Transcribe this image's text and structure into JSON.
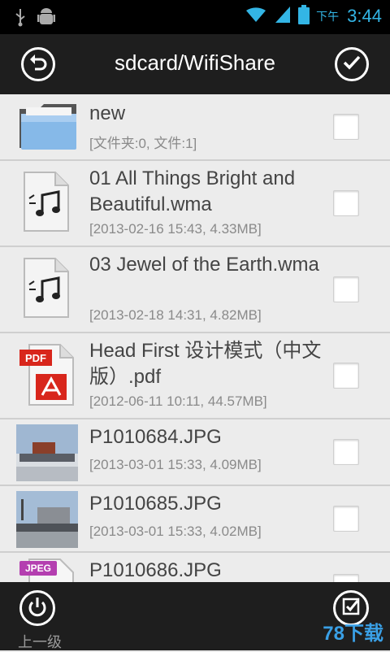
{
  "status": {
    "ampm": "下午",
    "time": "3:44"
  },
  "header": {
    "title": "sdcard/WifiShare"
  },
  "files": [
    {
      "name": "new",
      "meta": "[文件夹:0, 文件:1]",
      "icon": "folder-icon"
    },
    {
      "name": "01 All Things Bright and Beautiful.wma",
      "meta": "[2013-02-16 15:43, 4.33MB]",
      "icon": "audio-file-icon"
    },
    {
      "name": "03 Jewel of the Earth.wma",
      "meta": "[2013-02-18 14:31, 4.82MB]",
      "icon": "audio-file-icon"
    },
    {
      "name": "Head First 设计模式（中文版）.pdf",
      "meta": "[2012-06-11 10:11, 44.57MB]",
      "icon": "pdf-file-icon",
      "badge": "PDF"
    },
    {
      "name": "P1010684.JPG",
      "meta": "[2013-03-01 15:33, 4.09MB]",
      "icon": "photo-thumbnail"
    },
    {
      "name": "P1010685.JPG",
      "meta": "[2013-03-01 15:33, 4.02MB]",
      "icon": "photo-thumbnail"
    },
    {
      "name": "P1010686.JPG",
      "meta": "",
      "icon": "jpeg-file-icon",
      "badge": "JPEG"
    }
  ],
  "bottom": {
    "up_label": "上一级"
  },
  "watermark": "78下载"
}
